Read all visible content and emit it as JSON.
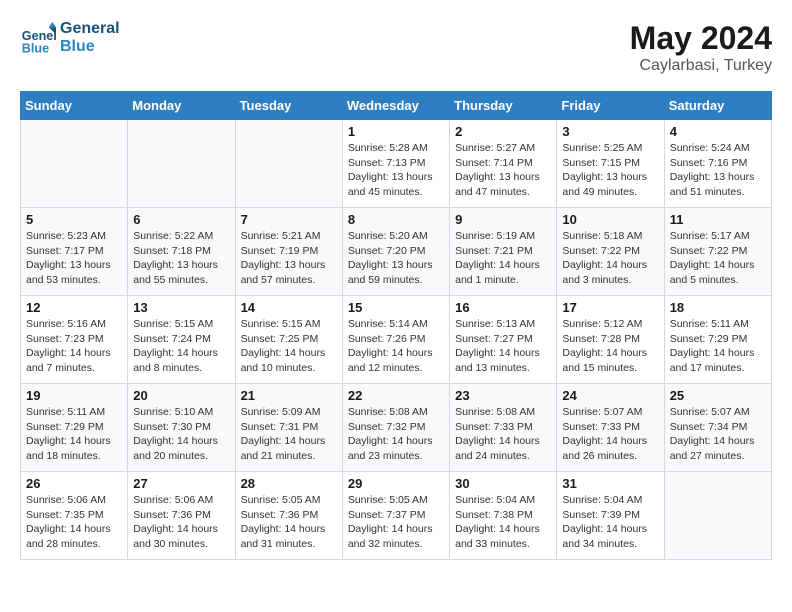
{
  "header": {
    "logo_line1": "General",
    "logo_line2": "Blue",
    "month_year": "May 2024",
    "location": "Caylarbasi, Turkey"
  },
  "weekdays": [
    "Sunday",
    "Monday",
    "Tuesday",
    "Wednesday",
    "Thursday",
    "Friday",
    "Saturday"
  ],
  "weeks": [
    [
      {
        "day": "",
        "info": ""
      },
      {
        "day": "",
        "info": ""
      },
      {
        "day": "",
        "info": ""
      },
      {
        "day": "1",
        "info": "Sunrise: 5:28 AM\nSunset: 7:13 PM\nDaylight: 13 hours\nand 45 minutes."
      },
      {
        "day": "2",
        "info": "Sunrise: 5:27 AM\nSunset: 7:14 PM\nDaylight: 13 hours\nand 47 minutes."
      },
      {
        "day": "3",
        "info": "Sunrise: 5:25 AM\nSunset: 7:15 PM\nDaylight: 13 hours\nand 49 minutes."
      },
      {
        "day": "4",
        "info": "Sunrise: 5:24 AM\nSunset: 7:16 PM\nDaylight: 13 hours\nand 51 minutes."
      }
    ],
    [
      {
        "day": "5",
        "info": "Sunrise: 5:23 AM\nSunset: 7:17 PM\nDaylight: 13 hours\nand 53 minutes."
      },
      {
        "day": "6",
        "info": "Sunrise: 5:22 AM\nSunset: 7:18 PM\nDaylight: 13 hours\nand 55 minutes."
      },
      {
        "day": "7",
        "info": "Sunrise: 5:21 AM\nSunset: 7:19 PM\nDaylight: 13 hours\nand 57 minutes."
      },
      {
        "day": "8",
        "info": "Sunrise: 5:20 AM\nSunset: 7:20 PM\nDaylight: 13 hours\nand 59 minutes."
      },
      {
        "day": "9",
        "info": "Sunrise: 5:19 AM\nSunset: 7:21 PM\nDaylight: 14 hours\nand 1 minute."
      },
      {
        "day": "10",
        "info": "Sunrise: 5:18 AM\nSunset: 7:22 PM\nDaylight: 14 hours\nand 3 minutes."
      },
      {
        "day": "11",
        "info": "Sunrise: 5:17 AM\nSunset: 7:22 PM\nDaylight: 14 hours\nand 5 minutes."
      }
    ],
    [
      {
        "day": "12",
        "info": "Sunrise: 5:16 AM\nSunset: 7:23 PM\nDaylight: 14 hours\nand 7 minutes."
      },
      {
        "day": "13",
        "info": "Sunrise: 5:15 AM\nSunset: 7:24 PM\nDaylight: 14 hours\nand 8 minutes."
      },
      {
        "day": "14",
        "info": "Sunrise: 5:15 AM\nSunset: 7:25 PM\nDaylight: 14 hours\nand 10 minutes."
      },
      {
        "day": "15",
        "info": "Sunrise: 5:14 AM\nSunset: 7:26 PM\nDaylight: 14 hours\nand 12 minutes."
      },
      {
        "day": "16",
        "info": "Sunrise: 5:13 AM\nSunset: 7:27 PM\nDaylight: 14 hours\nand 13 minutes."
      },
      {
        "day": "17",
        "info": "Sunrise: 5:12 AM\nSunset: 7:28 PM\nDaylight: 14 hours\nand 15 minutes."
      },
      {
        "day": "18",
        "info": "Sunrise: 5:11 AM\nSunset: 7:29 PM\nDaylight: 14 hours\nand 17 minutes."
      }
    ],
    [
      {
        "day": "19",
        "info": "Sunrise: 5:11 AM\nSunset: 7:29 PM\nDaylight: 14 hours\nand 18 minutes."
      },
      {
        "day": "20",
        "info": "Sunrise: 5:10 AM\nSunset: 7:30 PM\nDaylight: 14 hours\nand 20 minutes."
      },
      {
        "day": "21",
        "info": "Sunrise: 5:09 AM\nSunset: 7:31 PM\nDaylight: 14 hours\nand 21 minutes."
      },
      {
        "day": "22",
        "info": "Sunrise: 5:08 AM\nSunset: 7:32 PM\nDaylight: 14 hours\nand 23 minutes."
      },
      {
        "day": "23",
        "info": "Sunrise: 5:08 AM\nSunset: 7:33 PM\nDaylight: 14 hours\nand 24 minutes."
      },
      {
        "day": "24",
        "info": "Sunrise: 5:07 AM\nSunset: 7:33 PM\nDaylight: 14 hours\nand 26 minutes."
      },
      {
        "day": "25",
        "info": "Sunrise: 5:07 AM\nSunset: 7:34 PM\nDaylight: 14 hours\nand 27 minutes."
      }
    ],
    [
      {
        "day": "26",
        "info": "Sunrise: 5:06 AM\nSunset: 7:35 PM\nDaylight: 14 hours\nand 28 minutes."
      },
      {
        "day": "27",
        "info": "Sunrise: 5:06 AM\nSunset: 7:36 PM\nDaylight: 14 hours\nand 30 minutes."
      },
      {
        "day": "28",
        "info": "Sunrise: 5:05 AM\nSunset: 7:36 PM\nDaylight: 14 hours\nand 31 minutes."
      },
      {
        "day": "29",
        "info": "Sunrise: 5:05 AM\nSunset: 7:37 PM\nDaylight: 14 hours\nand 32 minutes."
      },
      {
        "day": "30",
        "info": "Sunrise: 5:04 AM\nSunset: 7:38 PM\nDaylight: 14 hours\nand 33 minutes."
      },
      {
        "day": "31",
        "info": "Sunrise: 5:04 AM\nSunset: 7:39 PM\nDaylight: 14 hours\nand 34 minutes."
      },
      {
        "day": "",
        "info": ""
      }
    ]
  ]
}
